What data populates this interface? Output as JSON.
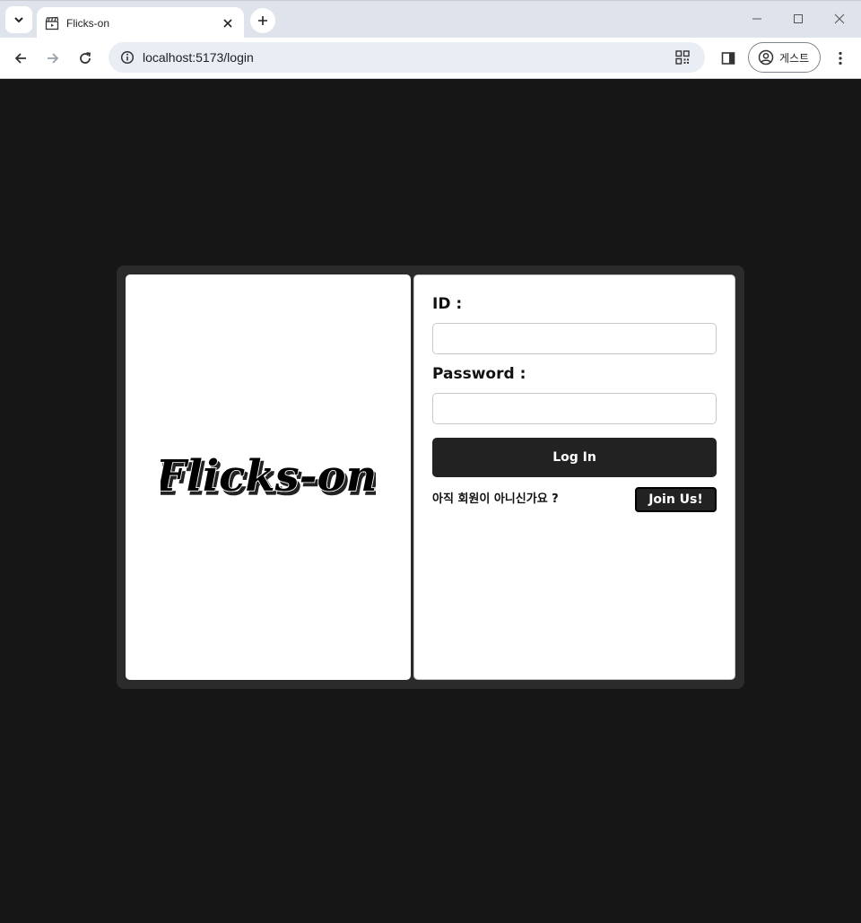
{
  "browser": {
    "tab_title": "Flicks-on",
    "url": "localhost:5173/login",
    "profile_label": "게스트"
  },
  "page": {
    "logo_text": "Flicks-on",
    "id_label": "ID :",
    "id_value": "",
    "password_label": "Password :",
    "password_value": "",
    "login_button": "Log In",
    "join_prompt": "아직 회원이 아니신가요 ?",
    "join_button": "Join Us!"
  },
  "colors": {
    "background": "#161616",
    "card": "#2b2b2b",
    "panel": "#ffffff",
    "button": "#222222"
  },
  "icons": {
    "tab_search": "chevron-down-icon",
    "favicon": "clapperboard-icon",
    "back": "arrow-left-icon",
    "forward": "arrow-right-icon",
    "reload": "reload-icon",
    "site_info": "info-icon",
    "qr": "qr-code-icon",
    "side_panel": "side-panel-icon",
    "profile": "user-circle-icon",
    "menu": "kebab-menu-icon"
  }
}
